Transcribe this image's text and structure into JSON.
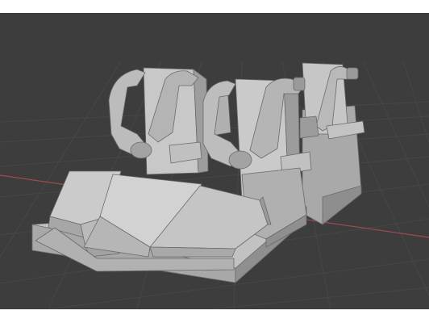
{
  "viewport": {
    "background": "#3d3d3d",
    "grid_color": "#474747",
    "x_axis_color": "#a34a52",
    "object": "coaster-seat-row-icon",
    "shading": "solid"
  },
  "colors": {
    "model_light": "#d0d0d0",
    "model_mid": "#b3b3b3",
    "model_dark": "#8e8e8e",
    "model_shadow": "#6a6a6a"
  }
}
